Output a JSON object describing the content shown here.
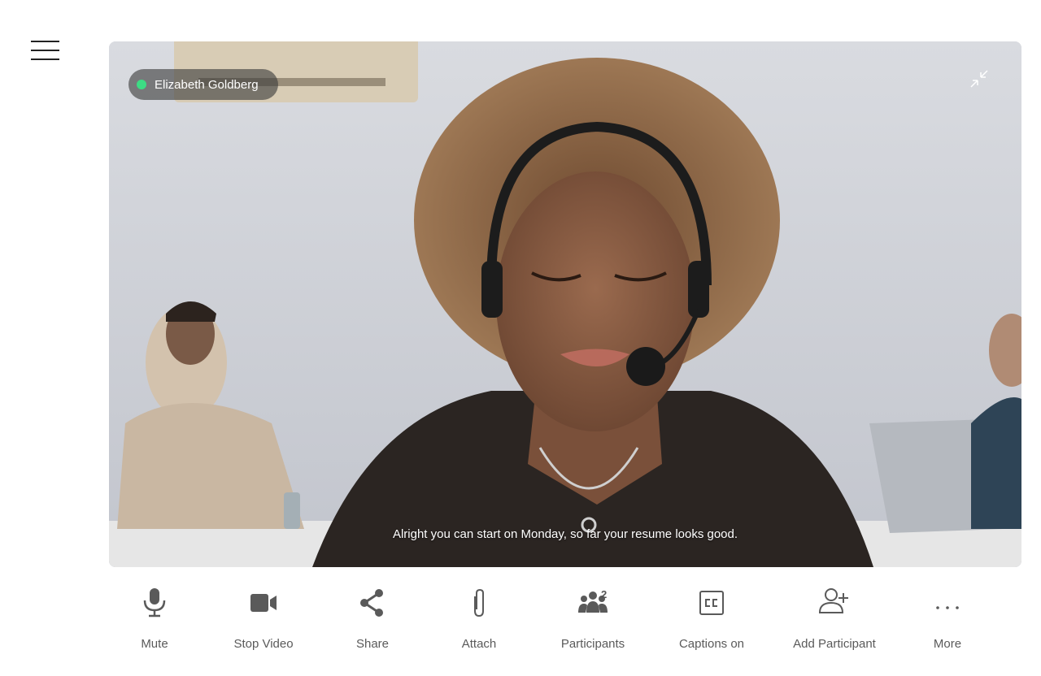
{
  "participant": {
    "name": "Elizabeth Goldberg",
    "status_color": "#3ddc84"
  },
  "caption": {
    "text": "Alright you can start on Monday, so far your resume looks good."
  },
  "icons": {
    "menu": "hamburger-menu-icon",
    "minimize": "minimize-icon"
  },
  "toolbar": {
    "mute_label": "Mute",
    "stop_video_label": "Stop Video",
    "share_label": "Share",
    "attach_label": "Attach",
    "participants_label": "Participants",
    "participants_count": "2",
    "captions_label": "Captions on",
    "add_participant_label": "Add Participant",
    "more_label": "More"
  },
  "colors": {
    "icon": "#5a5a5a",
    "status_online": "#3ddc84"
  }
}
